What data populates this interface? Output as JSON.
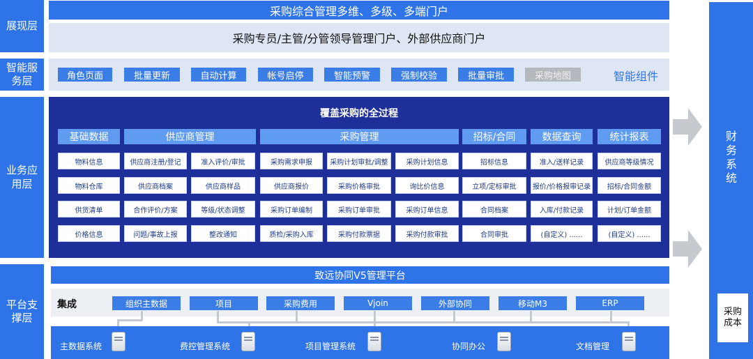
{
  "colors": {
    "primary_blue": "#2e74e8",
    "deep_blue": "#1e2f9a",
    "pale": "#dfe6f3",
    "cell_text": "#1f3c88"
  },
  "layers": {
    "presentation": "展现层",
    "smart_service": "智能服务层",
    "business": "业务应用层",
    "platform": "平台支撑层"
  },
  "presentation": {
    "line1": "采购综合管理多维、多级、多端门户",
    "line2": "采购专员/主管/分管领导管理门户、外部供应商门户"
  },
  "smart": {
    "buttons": [
      "角色页面",
      "批量更新",
      "自动计算",
      "帐号启停",
      "智能预警",
      "强制校验",
      "批量审批",
      "采购地图"
    ],
    "label": "智能组件"
  },
  "business": {
    "title": "覆盖采购的全过程",
    "categories": [
      "基础数据",
      "供应商管理",
      "采购管理",
      "招标/合同",
      "数据查询",
      "统计报表"
    ],
    "rows": [
      [
        "物料信息",
        "供应商注册/登记",
        "准入评价/审批",
        "采购需求申报",
        "采购计划审批/调整",
        "采购计划信息",
        "招标信息",
        "准入/送样记录",
        "供应商等级情况"
      ],
      [
        "物料仓库",
        "供应商档案",
        "供应商样品",
        "供应商报价",
        "采购价格审批",
        "询比价信息",
        "立项/定标审批",
        "报价/价格报审记录",
        "招标/合同金额"
      ],
      [
        "供货清单",
        "合作评价/方案",
        "等级/状态调整",
        "采购订单编制",
        "采购订单审批",
        "采购订单信息",
        "合同档案",
        "入库/付款记录",
        "计划/订单金额"
      ],
      [
        "价格信息",
        "问题/事故上报",
        "整改通知",
        "质检/采购入库",
        "采购付款票据",
        "采购付款审批",
        "合同审批",
        "(自定义)   ......",
        "(自定义)   ......"
      ]
    ]
  },
  "platform": {
    "title": "致远协同V5管理平台",
    "integration_label": "集成",
    "integration_items": [
      "组织主数据",
      "项目",
      "采购费用",
      "Vjoin",
      "外部协同",
      "移动M3",
      "ERP"
    ],
    "systems": [
      "主数据系统",
      "费控管理系统",
      "项目管理系统",
      "协同办公",
      "文档管理"
    ]
  },
  "right": {
    "finance_title": "财务系统",
    "cost_label": "采购成本"
  }
}
